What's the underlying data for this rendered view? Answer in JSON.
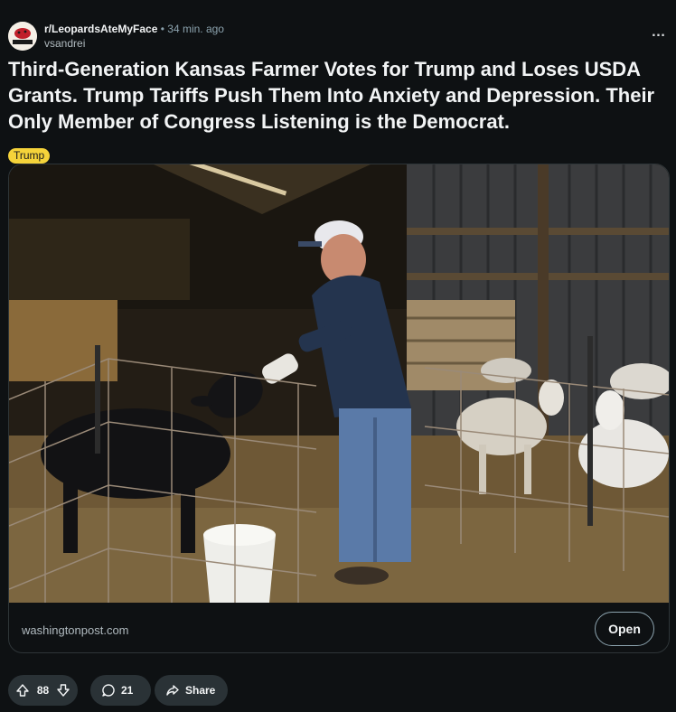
{
  "post": {
    "subreddit": "r/LeopardsAteMyFace",
    "separator": "•",
    "time": "34 min. ago",
    "author": "vsandrei",
    "more_label": "…",
    "title": "Third-Generation Kansas Farmer Votes for Trump and Loses USDA Grants. Trump Tariffs Push Them Into Anxiety and Depression. Their Only Member of Congress Listening is the Democrat.",
    "flair": "Trump",
    "subreddit_icon_text": "GOOD MEMBER"
  },
  "link_card": {
    "domain": "washingtonpost.com",
    "open_label": "Open",
    "image_description_icon": "photo-farmer-feeding-calf"
  },
  "actions": {
    "upvotes": "88",
    "comments": "21",
    "share_label": "Share"
  },
  "colors": {
    "background": "#0e1113",
    "flair_bg": "#f5d33a",
    "pill_bg": "#2a3236",
    "border": "#2e3538"
  }
}
